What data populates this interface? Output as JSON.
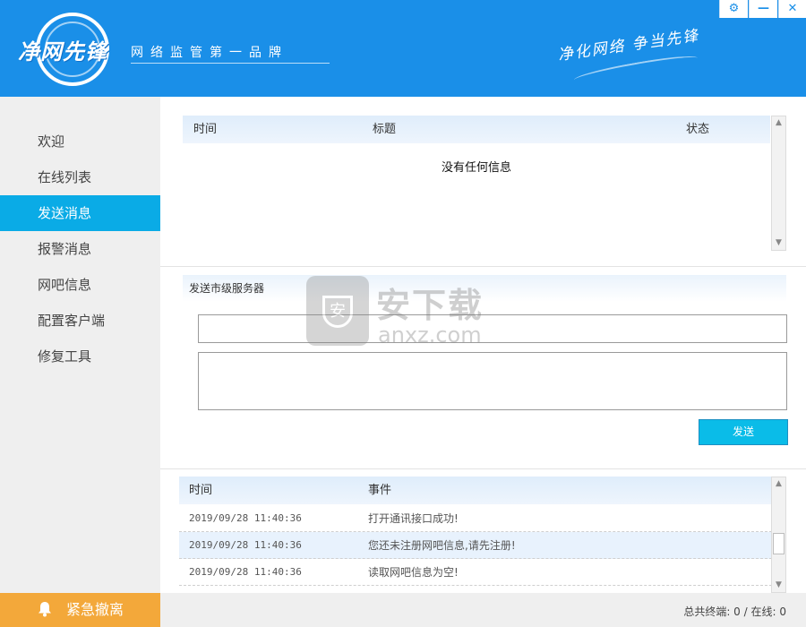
{
  "header": {
    "logo_text": "净网先锋",
    "slogan": "网络监管第一品牌",
    "motto": "净化网络 争当先锋"
  },
  "window_controls": {
    "settings": "⚙",
    "minimize": "—",
    "close": "✕"
  },
  "sidebar": {
    "items": [
      {
        "label": "欢迎",
        "active": false
      },
      {
        "label": "在线列表",
        "active": false
      },
      {
        "label": "发送消息",
        "active": true
      },
      {
        "label": "报警消息",
        "active": false
      },
      {
        "label": "网吧信息",
        "active": false
      },
      {
        "label": "配置客户端",
        "active": false
      },
      {
        "label": "修复工具",
        "active": false
      }
    ],
    "emergency_label": "紧急撤离"
  },
  "messages_table": {
    "columns": [
      "时间",
      "标题",
      "状态"
    ],
    "empty_message": "没有任何信息"
  },
  "send_section": {
    "title": "发送市级服务器",
    "subject_value": "",
    "body_value": "",
    "send_label": "发送"
  },
  "event_log": {
    "columns": [
      "时间",
      "事件"
    ],
    "rows": [
      {
        "time": "2019/09/28 11:40:36",
        "event": "打开通讯接口成功!"
      },
      {
        "time": "2019/09/28 11:40:36",
        "event": "您还未注册网吧信息,请先注册!"
      },
      {
        "time": "2019/09/28 11:40:36",
        "event": "读取网吧信息为空!"
      }
    ]
  },
  "status_bar": {
    "text": "总共终端: 0 / 在线: 0"
  },
  "watermark": {
    "title": "安下载",
    "domain": "anxz.com"
  },
  "colors": {
    "header_blue": "#1a8fe8",
    "active_nav": "#0aabe6",
    "emergency": "#f3a83a",
    "send_button": "#0abce8"
  }
}
